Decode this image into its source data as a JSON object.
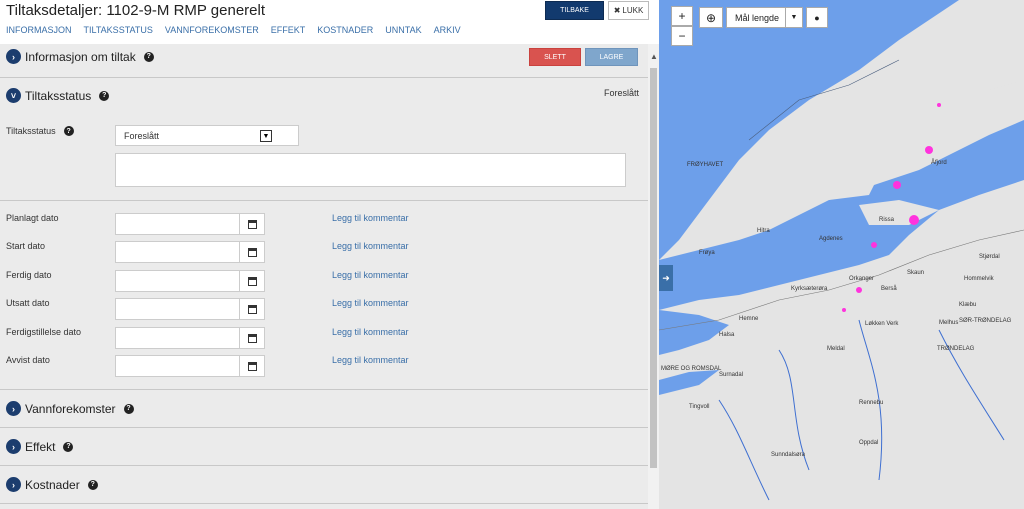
{
  "header": {
    "title": "Tiltaksdetaljer: 1102-9-M RMP generelt",
    "back_label": "TILBAKE",
    "close_label": "LUKK",
    "close_icon": "close-icon"
  },
  "tabs": [
    "INFORMASJON",
    "TILTAKSSTATUS",
    "VANNFOREKOMSTER",
    "EFFEKT",
    "KOSTNADER",
    "UNNTAK",
    "ARKIV"
  ],
  "sections": {
    "info": {
      "title": "Informasjon om tiltak",
      "delete_label": "SLETT",
      "save_label": "LAGRE"
    },
    "status": {
      "title": "Tiltaksstatus",
      "current_status": "Foreslått",
      "field_label": "Tiltaksstatus",
      "selected": "Foreslått"
    },
    "dates": [
      {
        "label": "Planlagt dato",
        "link": "Legg til kommentar"
      },
      {
        "label": "Start dato",
        "link": "Legg til kommentar"
      },
      {
        "label": "Ferdig dato",
        "link": "Legg til kommentar"
      },
      {
        "label": "Utsatt dato",
        "link": "Legg til kommentar"
      },
      {
        "label": "Ferdigstillelse dato",
        "link": "Legg til kommentar"
      },
      {
        "label": "Avvist dato",
        "link": "Legg til kommentar"
      }
    ],
    "water": {
      "title": "Vannforekomster"
    },
    "effect": {
      "title": "Effekt"
    },
    "costs": {
      "title": "Kostnader"
    }
  },
  "map": {
    "measure_label": "Mål lengde",
    "labels": [
      "FRØYHAVET",
      "Hitra",
      "Frøya",
      "Orkanger",
      "Kyrksæterøra",
      "Berså",
      "Løkken Verk",
      "TRØNDELAG",
      "Sunndalsøra",
      "Oppdal",
      "Skaun",
      "Melhus",
      "Klæbu",
      "Hemne",
      "Rissa",
      "Åfjord",
      "Agdenes",
      "Stjørdal",
      "Hommelvik",
      "Rennebu",
      "Meldal",
      "Surnadal",
      "Halsa",
      "Tingvoll",
      "MØRE OG ROMSDAL",
      "SØR-TRØNDELAG"
    ],
    "colors": {
      "sea": "#6d9fea",
      "land": "#e4e4e4",
      "highlight": "#ff33dd",
      "rivers": "#3e6fd1"
    }
  }
}
